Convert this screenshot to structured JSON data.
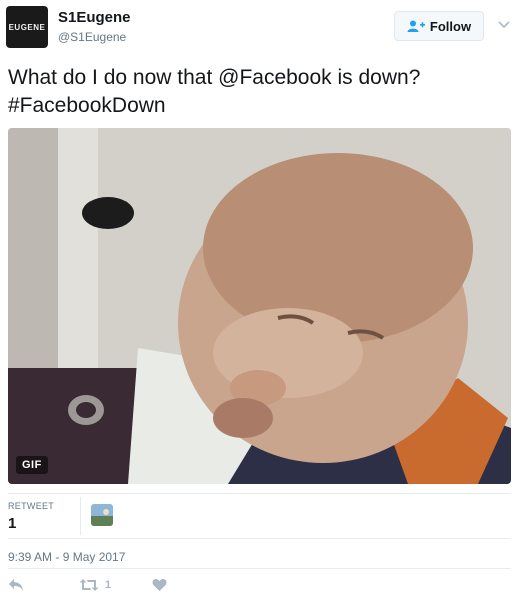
{
  "user": {
    "avatar_text": "EUGENE",
    "display_name": "S1Eugene",
    "handle": "@S1Eugene"
  },
  "follow_button": {
    "label": "Follow",
    "icon": "follow-user-icon"
  },
  "tweet": {
    "text_line1": "What do I do now that @Facebook is down?",
    "text_line2": "#FacebookDown"
  },
  "media": {
    "badge": "GIF"
  },
  "stats": {
    "retweet_label": "RETWEET",
    "retweet_count": "1"
  },
  "timestamp": "9:39 AM - 9 May 2017",
  "actions": {
    "reply_icon": "reply-icon",
    "retweet_icon": "retweet-icon",
    "retweet_count": "1",
    "like_icon": "heart-icon"
  },
  "colors": {
    "text": "#14171a",
    "muted": "#657786",
    "icon": "#aab8c2",
    "follow_icon": "#1da1f2"
  }
}
